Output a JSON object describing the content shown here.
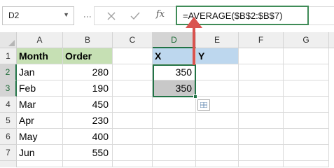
{
  "formula_bar": {
    "name_box": "D2",
    "cancel_icon": "x-icon",
    "enter_icon": "check-icon",
    "fx_label": "fx",
    "formula": "=AVERAGE($B$2:$B$7)"
  },
  "columns": [
    "A",
    "B",
    "C",
    "D",
    "E",
    "F",
    "G"
  ],
  "rows": [
    "1",
    "2",
    "3",
    "4",
    "5",
    "6",
    "7"
  ],
  "table": {
    "header": {
      "month": "Month",
      "order": "Order"
    },
    "data": [
      {
        "month": "Jan",
        "order": "280"
      },
      {
        "month": "Feb",
        "order": "190"
      },
      {
        "month": "Mar",
        "order": "450"
      },
      {
        "month": "Apr",
        "order": "230"
      },
      {
        "month": "May",
        "order": "400"
      },
      {
        "month": "Jun",
        "order": "550"
      }
    ]
  },
  "xy": {
    "x_header": "X",
    "y_header": "Y",
    "values": [
      "350",
      "350"
    ]
  },
  "colors": {
    "accent": "#217346",
    "arrow": "#d9534f",
    "month_header_bg": "#c6e0b4",
    "xy_header_bg": "#bdd7ee"
  }
}
